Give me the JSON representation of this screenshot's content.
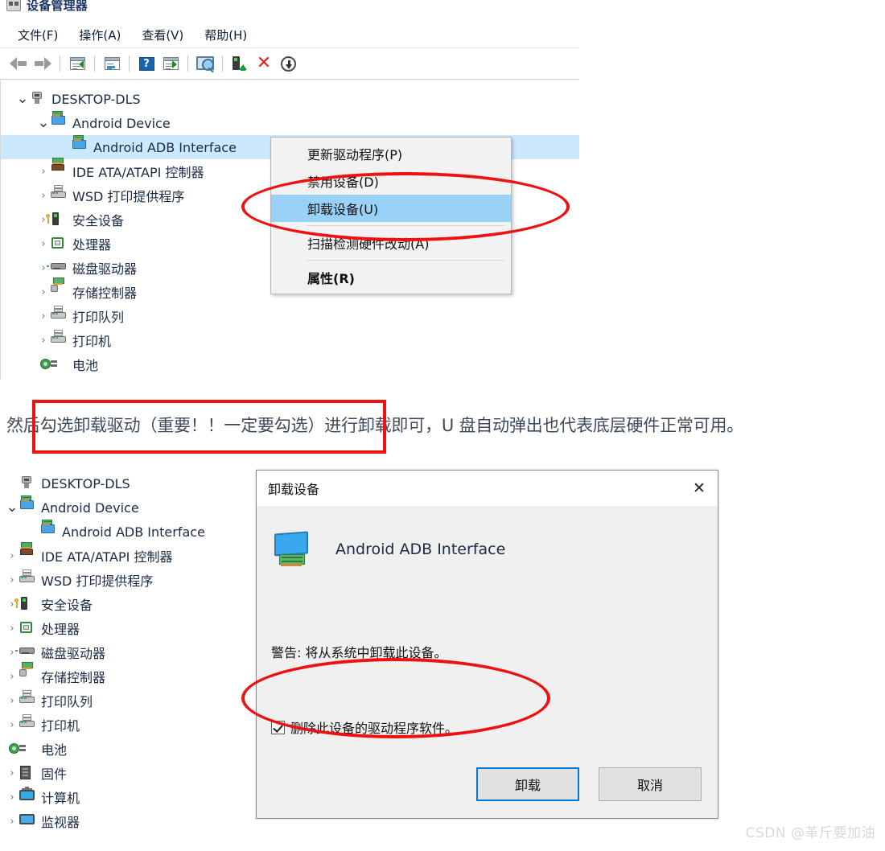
{
  "window": {
    "title": "设备管理器",
    "icon": "device-manager-icon",
    "menus": [
      "文件(F)",
      "操作(A)",
      "查看(V)",
      "帮助(H)"
    ],
    "toolbar": [
      {
        "name": "back-arrow-icon",
        "label": "后退"
      },
      {
        "name": "forward-arrow-icon",
        "label": "前进"
      },
      {
        "name": "show-hide-console-tree-icon",
        "label": "显示/隐藏控制台树"
      },
      {
        "name": "properties-icon",
        "label": "属性"
      },
      {
        "name": "help-icon",
        "label": "帮助"
      },
      {
        "name": "scan-hardware-icon",
        "label": "扫描检测硬件改动"
      },
      {
        "name": "display-icon",
        "label": "显示"
      },
      {
        "name": "update-driver-icon",
        "label": "更新驱动程序"
      },
      {
        "name": "uninstall-device-icon",
        "label": "卸载设备"
      },
      {
        "name": "disable-device-icon",
        "label": "禁用设备"
      }
    ]
  },
  "tree_top": [
    {
      "label": "DESKTOP-DLS",
      "indent": 0,
      "chevron": "open",
      "icon": "computer-root-icon",
      "selected": false
    },
    {
      "label": "Android Device",
      "indent": 1,
      "chevron": "open",
      "icon": "network-adapter-icon",
      "selected": false
    },
    {
      "label": "Android ADB Interface",
      "indent": 2,
      "chevron": "none",
      "icon": "network-adapter-icon",
      "selected": true
    },
    {
      "label": "IDE ATA/ATAPI 控制器",
      "indent": 1,
      "chevron": "closed",
      "icon": "ide-controller-icon",
      "selected": false
    },
    {
      "label": "WSD 打印提供程序",
      "indent": 1,
      "chevron": "closed",
      "icon": "printer-icon",
      "selected": false
    },
    {
      "label": "安全设备",
      "indent": 1,
      "chevron": "closed",
      "icon": "security-device-icon",
      "selected": false
    },
    {
      "label": "处理器",
      "indent": 1,
      "chevron": "closed",
      "icon": "cpu-icon",
      "selected": false
    },
    {
      "label": "磁盘驱动器",
      "indent": 1,
      "chevron": "closed",
      "icon": "disk-drive-icon",
      "selected": false
    },
    {
      "label": "存储控制器",
      "indent": 1,
      "chevron": "closed",
      "icon": "storage-controller-icon",
      "selected": false
    },
    {
      "label": "打印队列",
      "indent": 1,
      "chevron": "closed",
      "icon": "printer-icon",
      "selected": false
    },
    {
      "label": "打印机",
      "indent": 1,
      "chevron": "closed",
      "icon": "printer-icon",
      "selected": false
    },
    {
      "label": "电池",
      "indent": 1,
      "chevron": "closed",
      "icon": "battery-icon",
      "selected": false
    }
  ],
  "context_menu": [
    {
      "label": "更新驱动程序(P)",
      "highlighted": false,
      "bold": false,
      "divider_after": false
    },
    {
      "label": "禁用设备(D)",
      "highlighted": false,
      "bold": false,
      "divider_after": false
    },
    {
      "label": "卸载设备(U)",
      "highlighted": true,
      "bold": false,
      "divider_after": true
    },
    {
      "label": "扫描检测硬件改动(A)",
      "highlighted": false,
      "bold": false,
      "divider_after": true
    },
    {
      "label": "属性(R)",
      "highlighted": false,
      "bold": true,
      "divider_after": false
    }
  ],
  "paragraph": {
    "before": "然后",
    "highlighted": "勾选卸载驱动（重要！！一定要勾选）",
    "after": "进行卸载即可，U 盘自动弹出也代表底层硬件正常可用。"
  },
  "tree_bottom": [
    {
      "label": "DESKTOP-DLS",
      "indent": 0,
      "chevron": "none",
      "icon": "computer-root-icon"
    },
    {
      "label": "Android Device",
      "indent": 0,
      "chevron": "open",
      "icon": "network-adapter-icon"
    },
    {
      "label": "Android ADB Interface",
      "indent": 1,
      "chevron": "none",
      "icon": "network-adapter-icon"
    },
    {
      "label": "IDE ATA/ATAPI 控制器",
      "indent": 0,
      "chevron": "closed",
      "icon": "ide-controller-icon"
    },
    {
      "label": "WSD 打印提供程序",
      "indent": 0,
      "chevron": "closed",
      "icon": "printer-icon"
    },
    {
      "label": "安全设备",
      "indent": 0,
      "chevron": "closed",
      "icon": "security-device-icon"
    },
    {
      "label": "处理器",
      "indent": 0,
      "chevron": "closed",
      "icon": "cpu-icon"
    },
    {
      "label": "磁盘驱动器",
      "indent": 0,
      "chevron": "closed",
      "icon": "disk-drive-icon"
    },
    {
      "label": "存储控制器",
      "indent": 0,
      "chevron": "closed",
      "icon": "storage-controller-icon"
    },
    {
      "label": "打印队列",
      "indent": 0,
      "chevron": "closed",
      "icon": "printer-icon"
    },
    {
      "label": "打印机",
      "indent": 0,
      "chevron": "closed",
      "icon": "printer-icon"
    },
    {
      "label": "电池",
      "indent": 0,
      "chevron": "closed",
      "icon": "battery-icon"
    },
    {
      "label": "固件",
      "indent": 0,
      "chevron": "closed",
      "icon": "firmware-icon"
    },
    {
      "label": "计算机",
      "indent": 0,
      "chevron": "closed",
      "icon": "computer-icon"
    },
    {
      "label": "监视器",
      "indent": 0,
      "chevron": "closed",
      "icon": "monitor-icon"
    }
  ],
  "dialog": {
    "title": "卸载设备",
    "close_label": "✕",
    "device_name": "Android ADB Interface",
    "device_icon": "network-adapter-icon",
    "warning": "警告: 将从系统中卸载此设备。",
    "checkbox_label": "删除此设备的驱动程序软件。",
    "checkbox_checked": true,
    "primary_button": "卸载",
    "cancel_button": "取消"
  },
  "annotations": {
    "ellipse_menu": "红色椭圆标注-卸载设备",
    "ellipse_checkbox": "红色椭圆标注-删除驱动程序复选框",
    "rect_paragraph": "红色方框标注-勾选卸载驱动"
  },
  "watermark": "CSDN @革斤要加油",
  "colors": {
    "tree_selection": "#cce8ff",
    "menu_highlight": "#99d1f7",
    "annotation_red": "#ee1111",
    "primary_button_border": "#0078d7",
    "dialog_background": "#f0f0f0"
  }
}
